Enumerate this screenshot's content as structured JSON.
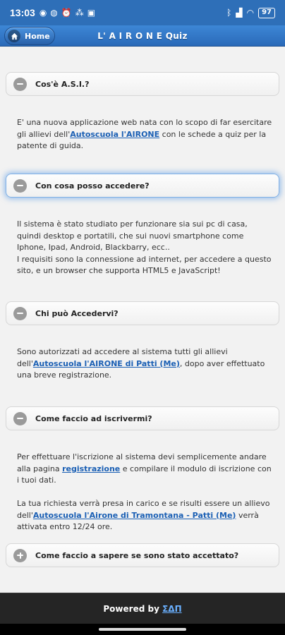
{
  "status": {
    "time": "13:03",
    "left_icons": [
      "whatsapp-icon",
      "messenger-icon",
      "alarm-icon",
      "network-icon",
      "gallery-icon"
    ],
    "battery": "97"
  },
  "header": {
    "home_label": "Home",
    "title": "L' A I R O N E Quiz"
  },
  "faq": [
    {
      "question": "Cos'è A.S.I.?",
      "expanded": true,
      "parts": [
        {
          "text": "E' una nuova applicazione web nata con lo scopo di far esercitare gli allievi dell'"
        },
        {
          "link": "Autoscuola l'AIRONE"
        },
        {
          "text": " con le schede a quiz per la patente di guida."
        }
      ]
    },
    {
      "question": "Con cosa posso accedere?",
      "expanded": true,
      "parts": [
        {
          "text": "Il sistema è stato studiato per funzionare sia sui pc di casa, quindi desktop e portatili, che sui nuovi smartphone come Iphone, Ipad, Android, Blackbarry, ecc.."
        },
        {
          "text": "I requisiti sono la connessione ad internet, per accedere a questo sito, e un browser che supporta HTML5 e JavaScript!"
        }
      ]
    },
    {
      "question": "Chi può Accedervi?",
      "expanded": true,
      "parts": [
        {
          "text": "Sono autorizzati ad accedere al sistema tutti gli allievi dell'"
        },
        {
          "link": "Autoscuola l'AIRONE di Patti (Me)"
        },
        {
          "text": ", dopo aver effettuato una breve registrazione."
        }
      ]
    },
    {
      "question": "Come faccio ad iscrivermi?",
      "expanded": true,
      "parts": [
        {
          "text": "Per effettuare l'iscrizione al sistema devi semplicemente andare alla pagina "
        },
        {
          "link": "registrazione"
        },
        {
          "text": " e compilare il modulo di iscrizione con i tuoi dati."
        },
        {
          "text": "La tua richiesta verrà presa in carico e se risulti essere un allievo dell'"
        },
        {
          "link": "Autoscuola l'Airone di Tramontana - Patti (Me)"
        },
        {
          "text": " verrà attivata entro 12/24 ore."
        }
      ]
    },
    {
      "question": "Come faccio a sapere se sono stato accettato?",
      "expanded": false,
      "parts": []
    }
  ],
  "footer": {
    "powered_by": "Powered by ",
    "brand": "ΣΔΠ"
  },
  "colors": {
    "header": "#2e6fb8",
    "link": "#1a5fb4",
    "footer": "#252525"
  }
}
